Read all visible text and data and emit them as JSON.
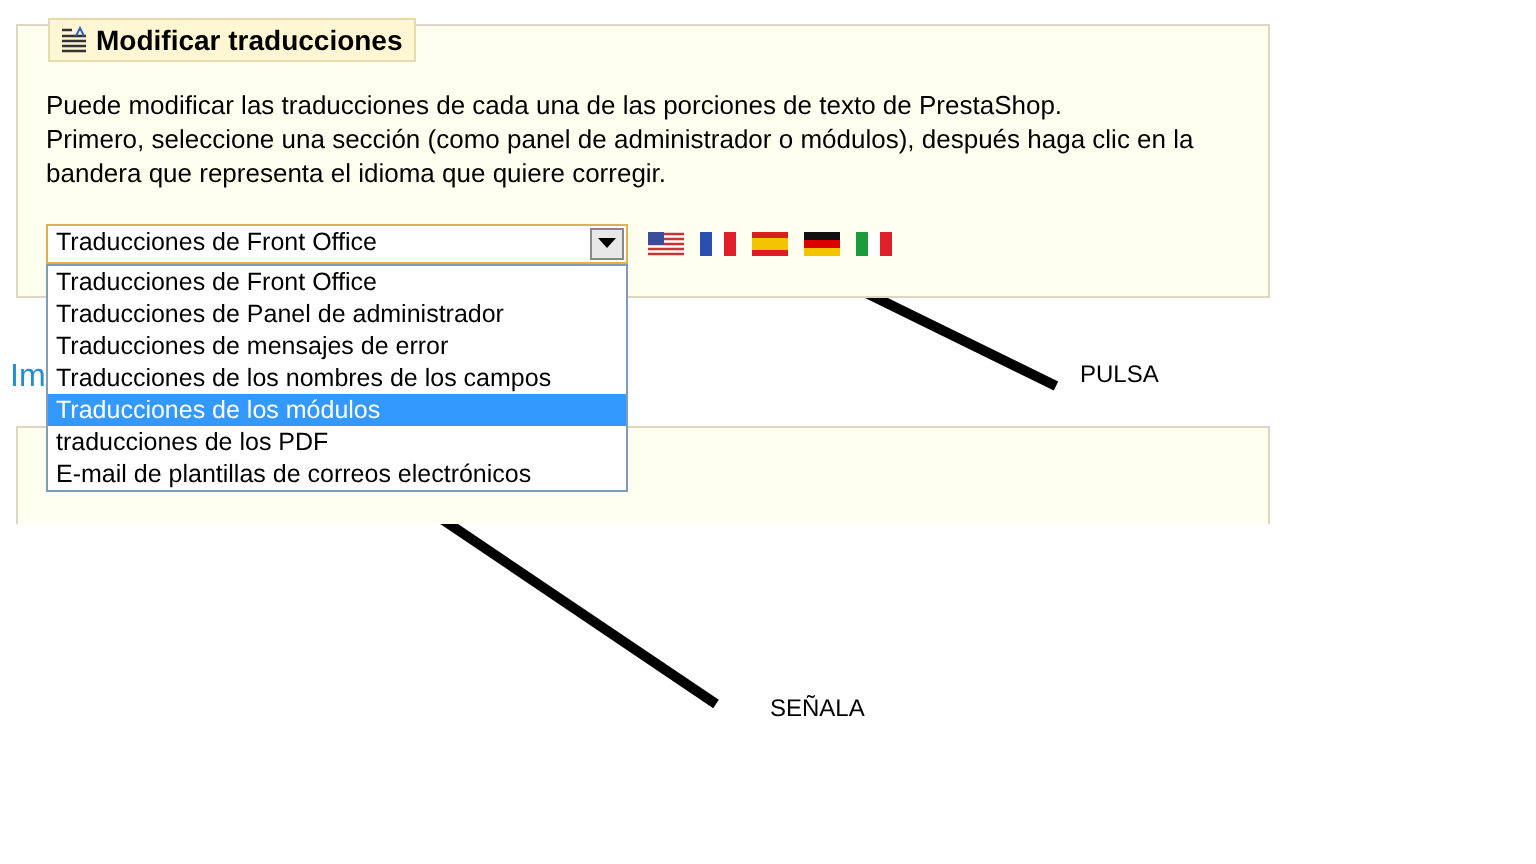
{
  "panel": {
    "title": "Modificar traducciones",
    "description": [
      "Puede modificar las traducciones de cada una de las porciones de texto de PrestaShop.",
      "Primero, seleccione una sección (como panel de administrador o módulos), después haga clic en la",
      "bandera que representa el idioma que quiere corregir."
    ],
    "select": {
      "value": "Traducciones de Front Office",
      "expanded": true,
      "options": [
        {
          "label": "Traducciones de Front Office",
          "highlighted": false
        },
        {
          "label": "Traducciones de Panel de administrador",
          "highlighted": false
        },
        {
          "label": "Traducciones de mensajes de error",
          "highlighted": false
        },
        {
          "label": "Traducciones de los nombres de los campos",
          "highlighted": false
        },
        {
          "label": "Traducciones de los módulos",
          "highlighted": true
        },
        {
          "label": "traducciones de los PDF",
          "highlighted": false
        },
        {
          "label": "E-mail de plantillas de correos electrónicos",
          "highlighted": false
        }
      ]
    },
    "flags": [
      {
        "kind": "us"
      },
      {
        "kind": "fr"
      },
      {
        "kind": "es"
      },
      {
        "kind": "de"
      },
      {
        "kind": "it"
      }
    ]
  },
  "section_heading": "Im",
  "annotations": [
    {
      "kind": "flag",
      "label": "PULSA"
    },
    {
      "kind": "option",
      "label": "SEÑALA"
    }
  ]
}
